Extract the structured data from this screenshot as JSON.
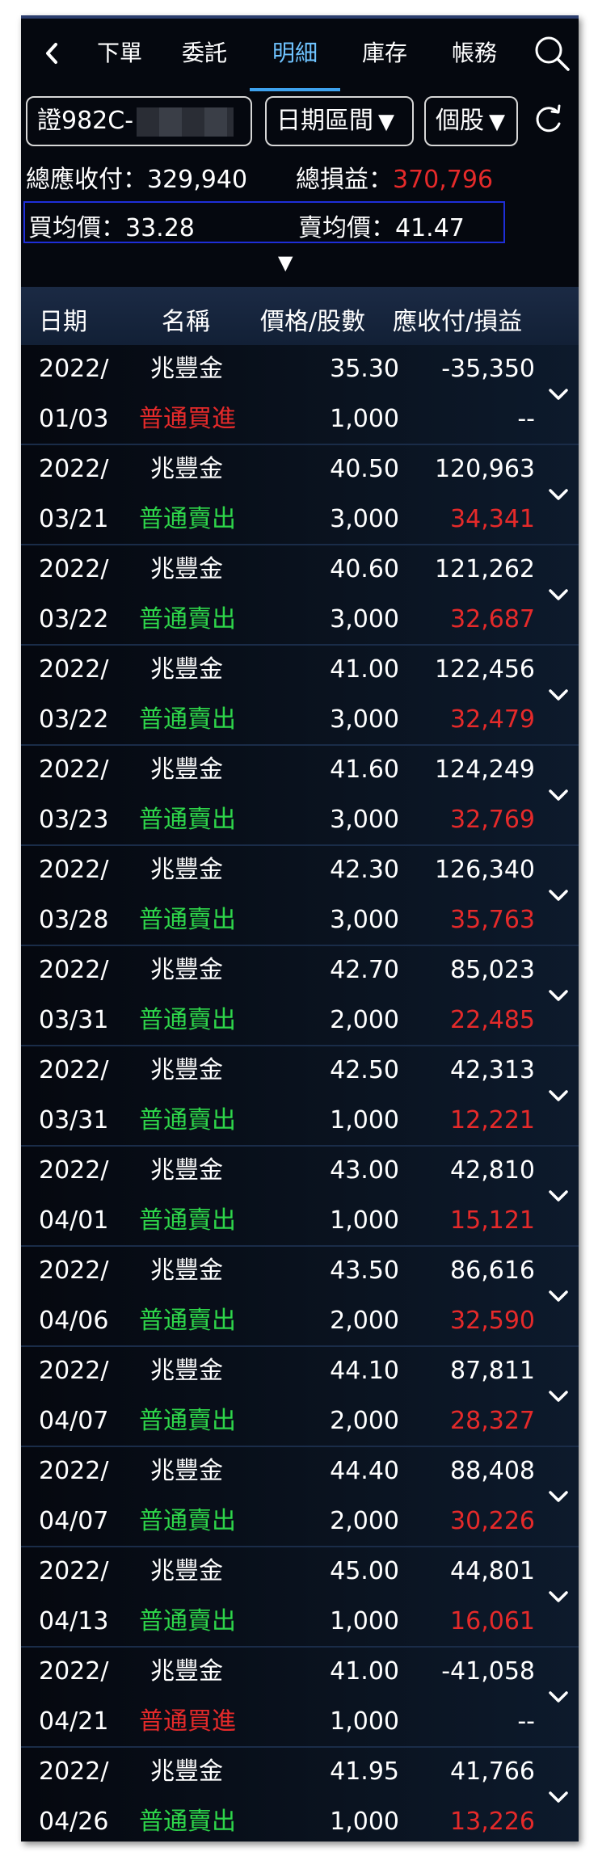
{
  "nav": {
    "tabs": [
      {
        "label": "下單",
        "active": false
      },
      {
        "label": "委託",
        "active": false
      },
      {
        "label": "明細",
        "active": true
      },
      {
        "label": "庫存",
        "active": false
      },
      {
        "label": "帳務",
        "active": false
      }
    ],
    "back_icon": "chevron-left-icon",
    "search_icon": "search-icon"
  },
  "filters": {
    "account_label": "證982C-",
    "date_label": "日期區間",
    "scope_label": "個股",
    "dropdown_arrow": "▼",
    "refresh_icon": "refresh-icon"
  },
  "summary": {
    "total_payable_label": "總應收付：",
    "total_payable_value": "329,940",
    "total_pnl_label": "總損益：",
    "total_pnl_value": "370,796",
    "buy_avg_label": "買均價：",
    "buy_avg_value": "33.28",
    "sell_avg_label": "賣均價：",
    "sell_avg_value": "41.47",
    "expand_arrow": "▼"
  },
  "table": {
    "headers": [
      "日期",
      "名稱",
      "價格/股數",
      "應收付/損益"
    ],
    "rows": [
      {
        "year": "2022/",
        "md": "01/03",
        "name": "兆豐金",
        "type": "普通買進",
        "side": "buy",
        "price": "35.30",
        "qty": "1,000",
        "amount": "-35,350",
        "pnl": "--"
      },
      {
        "year": "2022/",
        "md": "03/21",
        "name": "兆豐金",
        "type": "普通賣出",
        "side": "sell",
        "price": "40.50",
        "qty": "3,000",
        "amount": "120,963",
        "pnl": "34,341"
      },
      {
        "year": "2022/",
        "md": "03/22",
        "name": "兆豐金",
        "type": "普通賣出",
        "side": "sell",
        "price": "40.60",
        "qty": "3,000",
        "amount": "121,262",
        "pnl": "32,687"
      },
      {
        "year": "2022/",
        "md": "03/22",
        "name": "兆豐金",
        "type": "普通賣出",
        "side": "sell",
        "price": "41.00",
        "qty": "3,000",
        "amount": "122,456",
        "pnl": "32,479"
      },
      {
        "year": "2022/",
        "md": "03/23",
        "name": "兆豐金",
        "type": "普通賣出",
        "side": "sell",
        "price": "41.60",
        "qty": "3,000",
        "amount": "124,249",
        "pnl": "32,769"
      },
      {
        "year": "2022/",
        "md": "03/28",
        "name": "兆豐金",
        "type": "普通賣出",
        "side": "sell",
        "price": "42.30",
        "qty": "3,000",
        "amount": "126,340",
        "pnl": "35,763"
      },
      {
        "year": "2022/",
        "md": "03/31",
        "name": "兆豐金",
        "type": "普通賣出",
        "side": "sell",
        "price": "42.70",
        "qty": "2,000",
        "amount": "85,023",
        "pnl": "22,485"
      },
      {
        "year": "2022/",
        "md": "03/31",
        "name": "兆豐金",
        "type": "普通賣出",
        "side": "sell",
        "price": "42.50",
        "qty": "1,000",
        "amount": "42,313",
        "pnl": "12,221"
      },
      {
        "year": "2022/",
        "md": "04/01",
        "name": "兆豐金",
        "type": "普通賣出",
        "side": "sell",
        "price": "43.00",
        "qty": "1,000",
        "amount": "42,810",
        "pnl": "15,121"
      },
      {
        "year": "2022/",
        "md": "04/06",
        "name": "兆豐金",
        "type": "普通賣出",
        "side": "sell",
        "price": "43.50",
        "qty": "2,000",
        "amount": "86,616",
        "pnl": "32,590"
      },
      {
        "year": "2022/",
        "md": "04/07",
        "name": "兆豐金",
        "type": "普通賣出",
        "side": "sell",
        "price": "44.10",
        "qty": "2,000",
        "amount": "87,811",
        "pnl": "28,327"
      },
      {
        "year": "2022/",
        "md": "04/07",
        "name": "兆豐金",
        "type": "普通賣出",
        "side": "sell",
        "price": "44.40",
        "qty": "2,000",
        "amount": "88,408",
        "pnl": "30,226"
      },
      {
        "year": "2022/",
        "md": "04/13",
        "name": "兆豐金",
        "type": "普通賣出",
        "side": "sell",
        "price": "45.00",
        "qty": "1,000",
        "amount": "44,801",
        "pnl": "16,061"
      },
      {
        "year": "2022/",
        "md": "04/21",
        "name": "兆豐金",
        "type": "普通買進",
        "side": "buy",
        "price": "41.00",
        "qty": "1,000",
        "amount": "-41,058",
        "pnl": "--"
      },
      {
        "year": "2022/",
        "md": "04/26",
        "name": "兆豐金",
        "type": "普通賣出",
        "side": "sell",
        "price": "41.95",
        "qty": "1,000",
        "amount": "41,766",
        "pnl": "13,226"
      }
    ]
  },
  "colors": {
    "active_tab": "#6fc3ff",
    "profit": "#e52a2a",
    "buy": "#e52a2a",
    "sell": "#2ed64a",
    "highlight_box": "#1e2ed8",
    "background": "#05080f"
  }
}
